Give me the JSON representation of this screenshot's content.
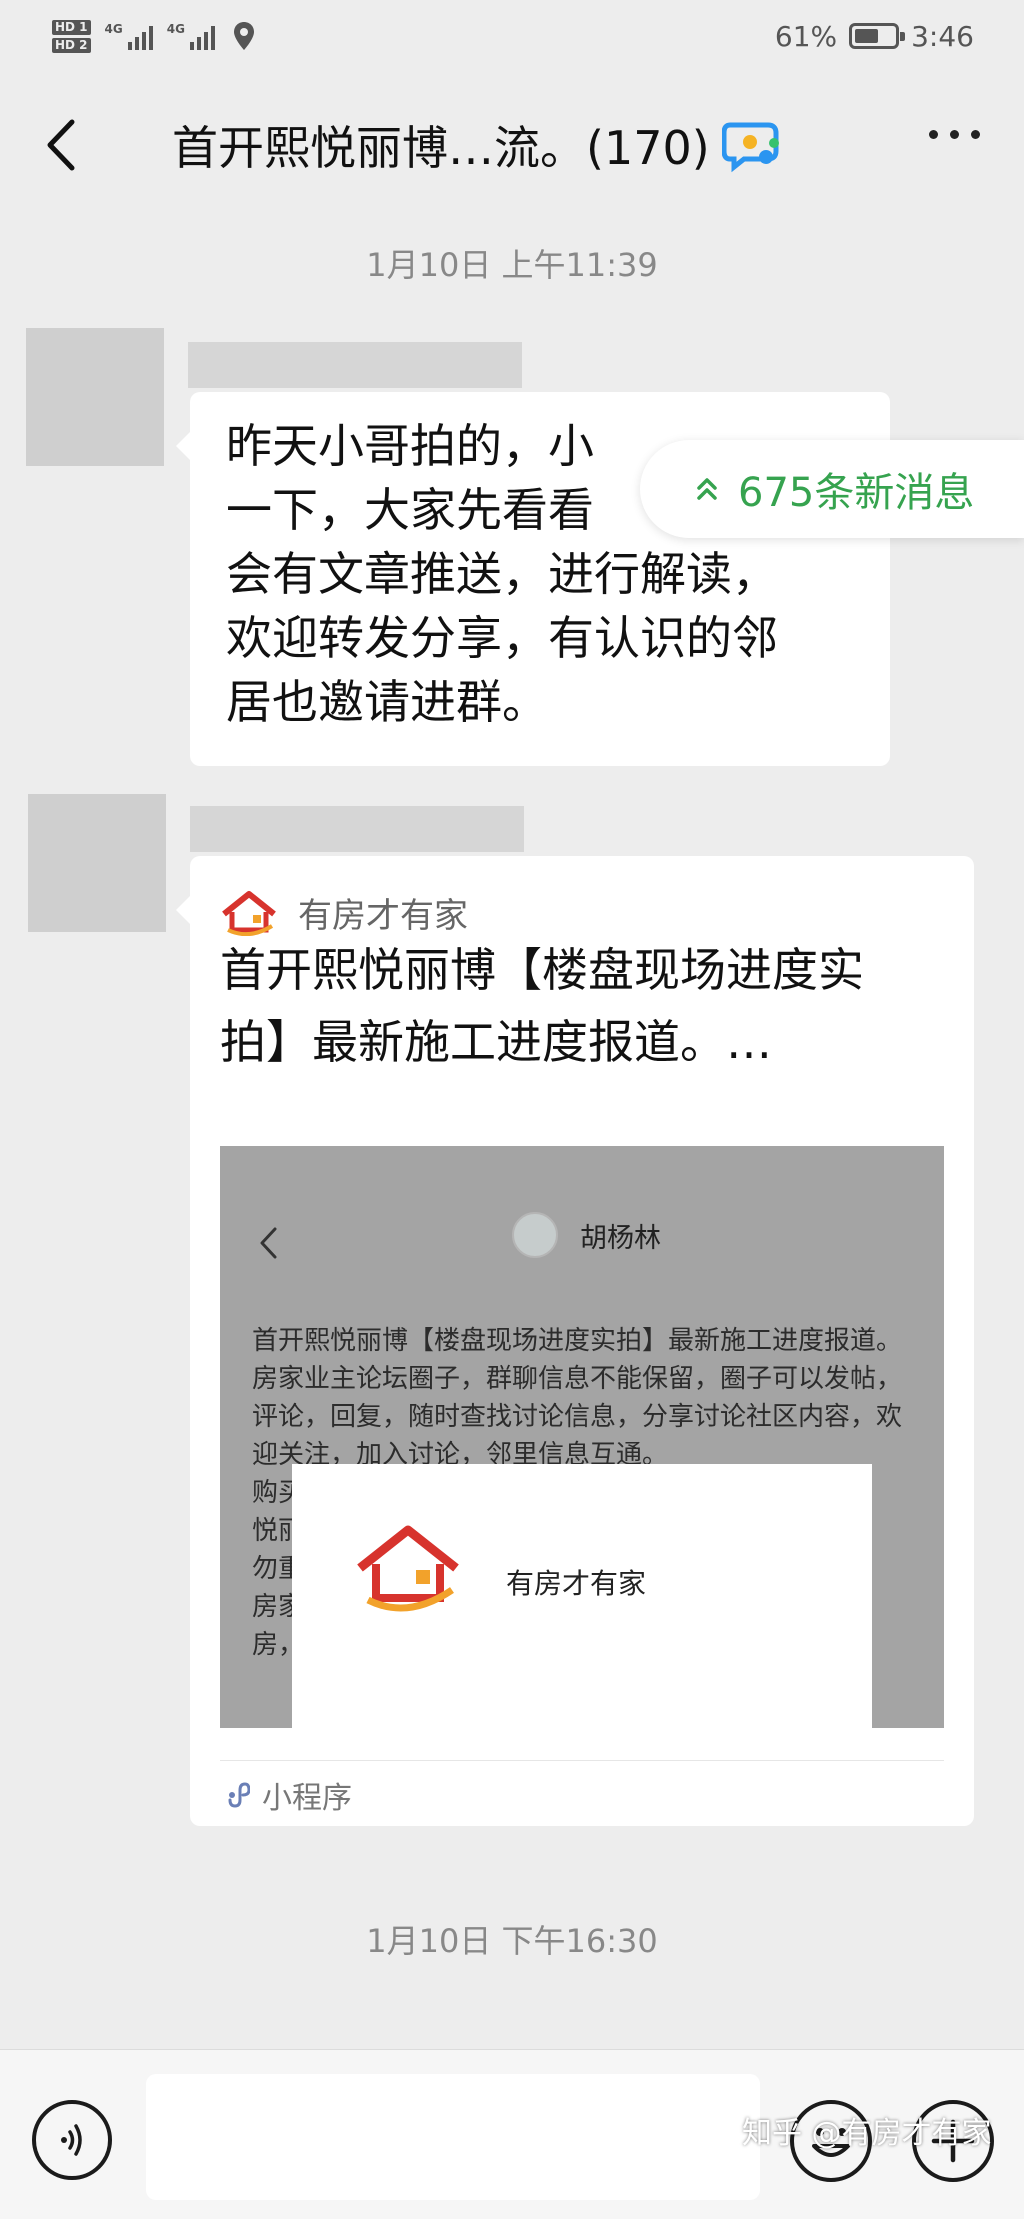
{
  "status_bar": {
    "hd1": "HD 1",
    "hd2": "HD 2",
    "network_1": "4G",
    "network_2": "4G",
    "battery_text": "61%",
    "battery_level": 0.61,
    "time": "3:46"
  },
  "nav": {
    "title": "首开熙悦丽博…流。(170)"
  },
  "new_messages_pill": {
    "label": "675条新消息"
  },
  "messages": [
    {
      "timestamp": "1月10日 上午11:39",
      "type": "text",
      "lines": [
        "昨天小哥拍的，小",
        "一下，大家先看看",
        "会有文章推送，进行解读，",
        "欢迎转发分享，有认识的邻",
        "居也邀请进群。"
      ]
    },
    {
      "type": "mini_program",
      "source": "有房才有家",
      "title_lines": [
        "首开熙悦丽博【楼盘现场进度实",
        "拍】最新施工进度报道。…"
      ],
      "preview": {
        "user": "胡杨林",
        "text_lines": [
          "首开熙悦丽博【楼盘现场进度实拍】最新施工进度报道。",
          "房家业主论坛圈子，群聊信息不能保留，圈子可以发帖，",
          "评论，回复，随时查找讨论信息，分享讨论社区内容，欢",
          "迎关注，加入讨论，邻里信息互通。",
          "购买",
          "悦丽",
          "勿重",
          "房家",
          "房，"
        ],
        "overlay_name": "有房才有家"
      },
      "footer": "小程序"
    }
  ],
  "timestamp_2": "1月10日 下午16:30",
  "input_bar": {
    "placeholder": ""
  },
  "watermark": "知乎 @有房才有家"
}
